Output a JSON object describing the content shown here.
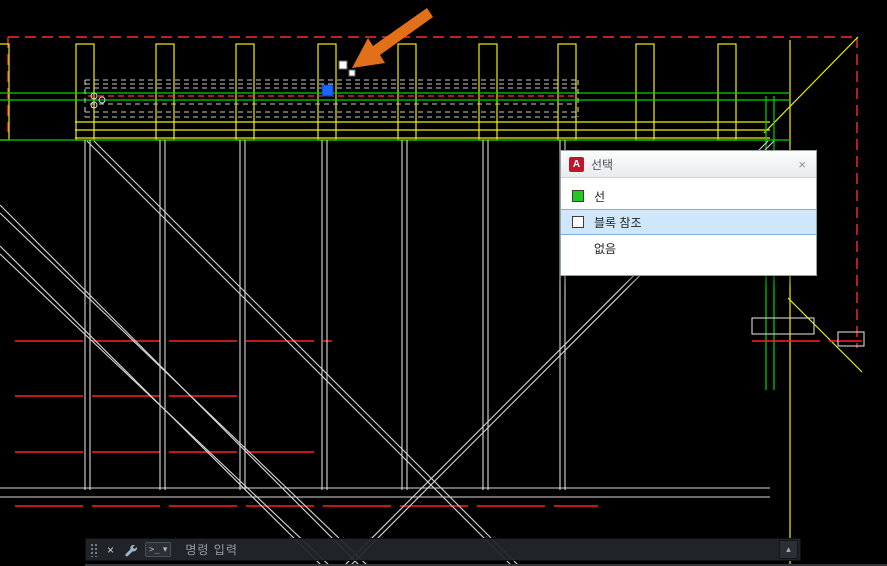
{
  "selection_dialog": {
    "title": "선택",
    "logo_letter": "A",
    "close_glyph": "×",
    "items": [
      {
        "label": "선",
        "swatch_color": "#1ecb1e",
        "highlighted": false
      },
      {
        "label": "블록 참조",
        "swatch_color": "#ffffff",
        "highlighted": true
      },
      {
        "label": "없음",
        "swatch_color": null,
        "highlighted": false
      }
    ]
  },
  "command_bar": {
    "placeholder": "명령 입력",
    "close_glyph": "×",
    "prompt_glyph": ">_",
    "dropdown_glyph": "▾",
    "scroll_up_glyph": "▴"
  },
  "icons": {
    "drag-handle": "dot-grid",
    "close-icon": "×",
    "customize-wrench-icon": "wrench-shape",
    "chevron-down-icon": "▾",
    "scroll-up-icon": "▴",
    "autocad-logo": "red square with white A"
  },
  "colors": {
    "background": "#000000",
    "boundary_red": "#ff2a2a",
    "structure_yellow": "#f0f000",
    "structure_green": "#00d400",
    "structure_white": "#d8d8d8",
    "selected_dash_gray": "#c8c8c8",
    "grip_blue": "#1a66ff",
    "annotation_orange": "#e2701b",
    "highlight_row_blue": "#cfe6fb"
  }
}
